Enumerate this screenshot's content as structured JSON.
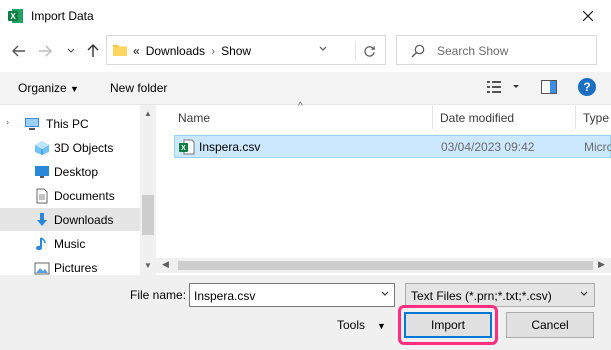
{
  "window": {
    "title": "Import Data",
    "app_icon": "excel-icon",
    "close_icon": "close-icon"
  },
  "nav": {
    "back_icon": "back-arrow-icon",
    "forward_icon": "forward-arrow-icon",
    "recent_icon": "chevron-down-icon",
    "up_icon": "up-arrow-icon",
    "address": {
      "overflow": "«",
      "segments": [
        "Downloads",
        "Show"
      ],
      "separator": "›"
    },
    "refresh_icon": "refresh-icon",
    "search_placeholder": "Search Show"
  },
  "toolbar": {
    "organize": "Organize",
    "new_folder": "New folder",
    "view_icon": "view-options-icon",
    "preview_icon": "preview-pane-icon",
    "help": "?"
  },
  "sidebar": {
    "items": [
      {
        "label": "This PC",
        "icon": "pc-icon",
        "top": true
      },
      {
        "label": "3D Objects",
        "icon": "3d-objects-icon"
      },
      {
        "label": "Desktop",
        "icon": "desktop-icon"
      },
      {
        "label": "Documents",
        "icon": "documents-icon"
      },
      {
        "label": "Downloads",
        "icon": "downloads-icon",
        "selected": true
      },
      {
        "label": "Music",
        "icon": "music-icon"
      },
      {
        "label": "Pictures",
        "icon": "pictures-icon"
      }
    ]
  },
  "columns": {
    "name": "Name",
    "date": "Date modified",
    "type": "Type"
  },
  "files": [
    {
      "name": "Inspera.csv",
      "date": "03/04/2023 09:42",
      "type": "Micro"
    }
  ],
  "footer": {
    "file_name_label": "File name:",
    "file_name_value": "Inspera.csv",
    "filter": "Text Files (*.prn;*.txt;*.csv)",
    "tools": "Tools",
    "import": "Import",
    "cancel": "Cancel"
  },
  "colors": {
    "accent": "#0078d7",
    "highlight": "#ff2e7e",
    "selection": "#cce8ff"
  }
}
